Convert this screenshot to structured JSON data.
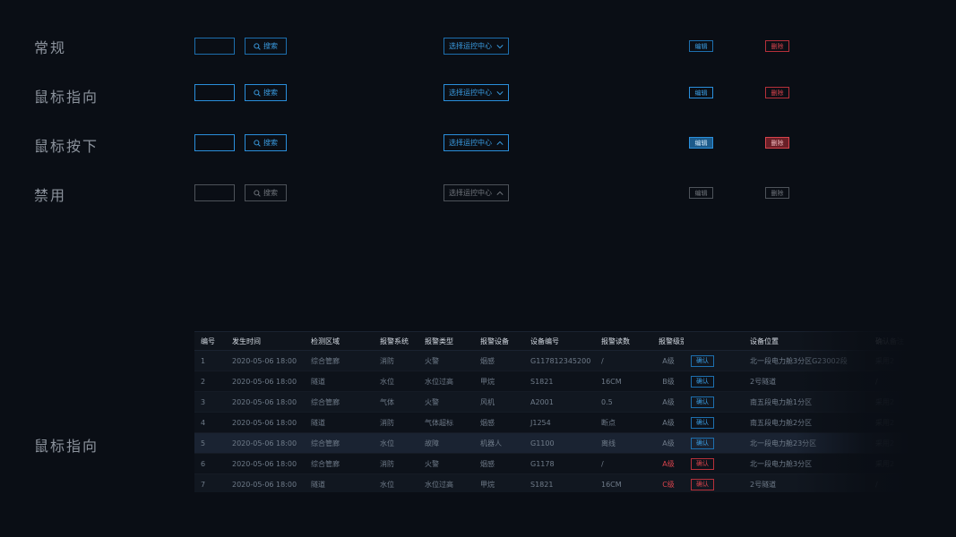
{
  "states": [
    {
      "label": "常规",
      "search_label": "搜索",
      "select_label": "选择运控中心",
      "select_chevron": "down",
      "edit_label": "编辑",
      "delete_label": "删除"
    },
    {
      "label": "鼠标指向",
      "search_label": "搜索",
      "select_label": "选择运控中心",
      "select_chevron": "down",
      "edit_label": "编辑",
      "delete_label": "删除"
    },
    {
      "label": "鼠标按下",
      "search_label": "搜索",
      "select_label": "选择运控中心",
      "select_chevron": "up",
      "edit_label": "编辑",
      "delete_label": "删除"
    },
    {
      "label": "禁用",
      "search_label": "搜索",
      "select_label": "选择运控中心",
      "select_chevron": "up",
      "edit_label": "编辑",
      "delete_label": "删除"
    }
  ],
  "table_section_label": "鼠标指向",
  "table": {
    "columns": [
      "编号",
      "发生时间",
      "检测区域",
      "报警系统",
      "报警类型",
      "报警设备",
      "设备编号",
      "报警读数",
      "报警级别",
      "",
      "设备位置",
      "确认备注"
    ],
    "rows": [
      {
        "id": "1",
        "time": "2020-05-06 18:00",
        "area": "综合管廊",
        "system": "消防",
        "type": "火警",
        "device": "烟感",
        "code": "G117812345200",
        "reading": "/",
        "level": "A级",
        "action": "确认",
        "location": "北一段电力舱3分区G23002段",
        "note": "采用2"
      },
      {
        "id": "2",
        "time": "2020-05-06 18:00",
        "area": "隧道",
        "system": "水位",
        "type": "水位过高",
        "device": "甲烷",
        "code": "S1821",
        "reading": "16CM",
        "level": "B级",
        "action": "确认",
        "location": "2号隧道",
        "note": "/"
      },
      {
        "id": "3",
        "time": "2020-05-06 18:00",
        "area": "综合管廊",
        "system": "气体",
        "type": "火警",
        "device": "风机",
        "code": "A2001",
        "reading": "0.5",
        "level": "A级",
        "action": "确认",
        "location": "南五段电力舱1分区",
        "note": "采用2"
      },
      {
        "id": "4",
        "time": "2020-05-06 18:00",
        "area": "隧道",
        "system": "消防",
        "type": "气体超标",
        "device": "烟感",
        "code": "J1254",
        "reading": "断点",
        "level": "A级",
        "action": "确认",
        "location": "南五段电力舱2分区",
        "note": "采用2"
      },
      {
        "id": "5",
        "time": "2020-05-06 18:00",
        "area": "综合管廊",
        "system": "水位",
        "type": "故障",
        "device": "机器人",
        "code": "G1100",
        "reading": "离线",
        "level": "A级",
        "action": "确认",
        "location": "北一段电力舱23分区",
        "note": "采用2"
      },
      {
        "id": "6",
        "time": "2020-05-06 18:00",
        "area": "综合管廊",
        "system": "消防",
        "type": "火警",
        "device": "烟感",
        "code": "G1178",
        "reading": "/",
        "level": "A级",
        "action": "确认",
        "location": "北一段电力舱3分区",
        "note": "采用2"
      },
      {
        "id": "7",
        "time": "2020-05-06 18:00",
        "area": "隧道",
        "system": "水位",
        "type": "水位过高",
        "device": "甲烷",
        "code": "S1821",
        "reading": "16CM",
        "level": "C级",
        "action": "确认",
        "location": "2号隧道",
        "note": "/"
      }
    ],
    "red_level_rows": [
      5,
      6
    ],
    "hovered_row": 4
  },
  "colors": {
    "background": "#0a0e15",
    "accent_blue": "#3a9be0",
    "border_blue": "#1d6fae",
    "danger_red": "#d8434c",
    "disabled_gray": "#4e535a"
  },
  "icons": {
    "search": "magnifier-icon",
    "chevron": "chevron-icon"
  }
}
